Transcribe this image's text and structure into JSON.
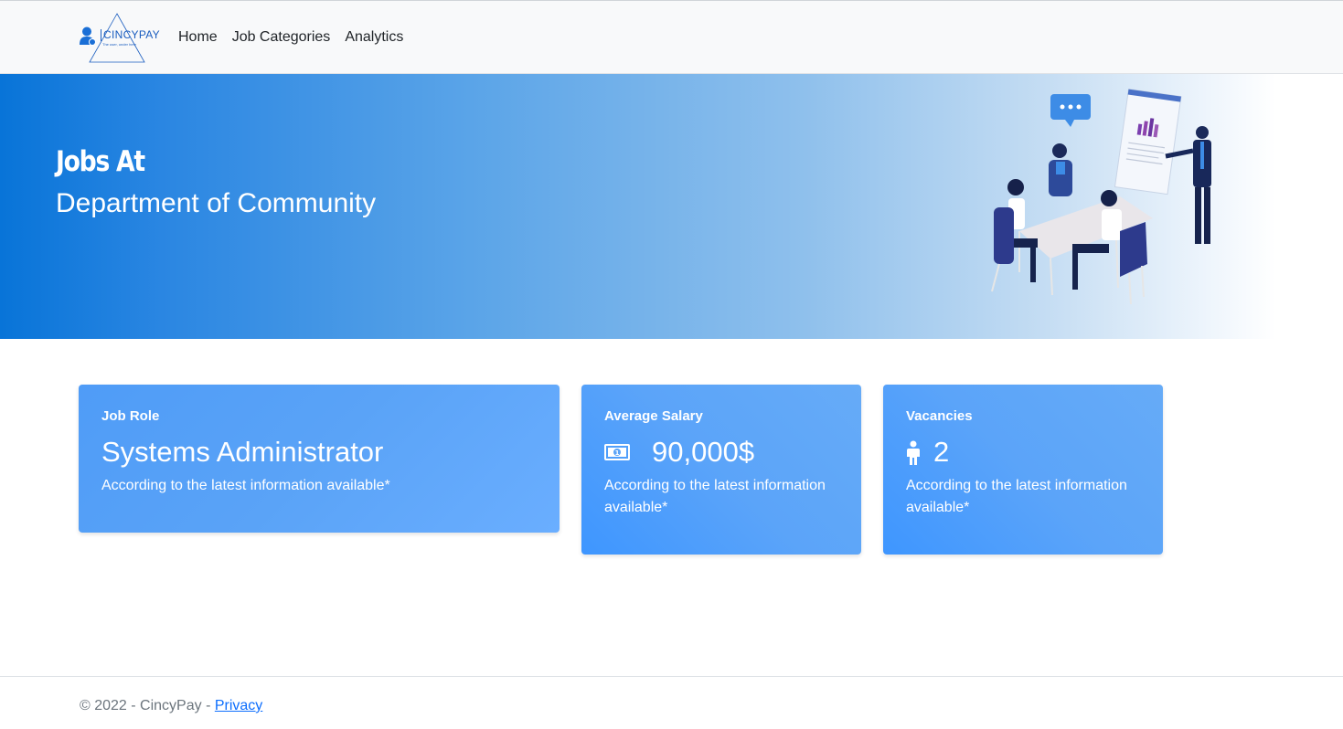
{
  "nav": {
    "brand_name": "CINCYPAY",
    "brand_tagline": "The user, under here",
    "links": [
      "Home",
      "Job Categories",
      "Analytics"
    ]
  },
  "hero": {
    "title": "Jobs At",
    "subtitle": "Department of Community"
  },
  "cards": {
    "role": {
      "label": "Job Role",
      "value": "Systems Administrator",
      "note": "According to the latest information available*"
    },
    "salary": {
      "label": "Average Salary",
      "value": "90,000$",
      "note": "According to the latest information available*",
      "icon": "money-bill-icon"
    },
    "vacancies": {
      "label": "Vacancies",
      "value": "2",
      "note": "According to the latest information available*",
      "icon": "person-icon"
    }
  },
  "footer": {
    "text": "© 2022 - CincyPay - ",
    "privacy_label": "Privacy"
  },
  "colors": {
    "brand": "#1a5dbf",
    "card": "#4f9cf7",
    "link": "#0d6efd"
  }
}
